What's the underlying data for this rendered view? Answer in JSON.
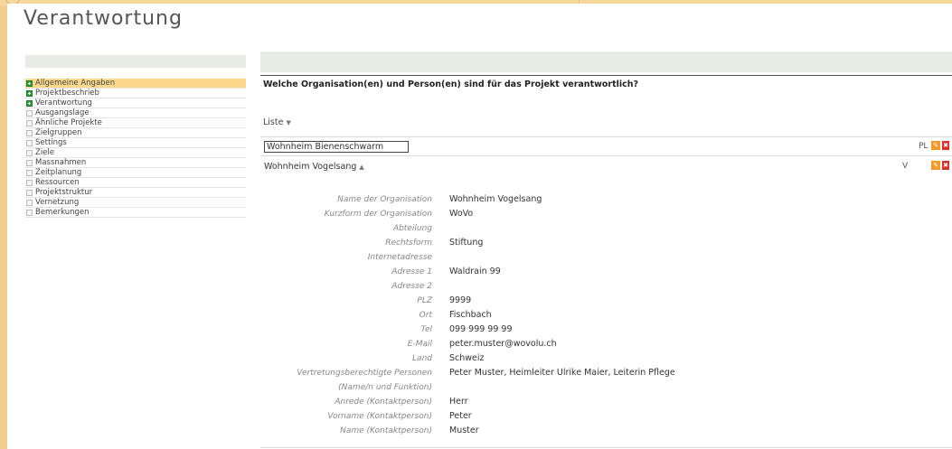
{
  "page": {
    "title": "Verantwortung"
  },
  "sidebar": {
    "items": [
      {
        "label": "Allgemeine Angaben",
        "state": "done",
        "active": true
      },
      {
        "label": "Projektbeschrieb",
        "state": "done",
        "active": false
      },
      {
        "label": "Verantwortung",
        "state": "done",
        "active": false
      },
      {
        "label": "Ausgangslage",
        "state": "empty",
        "active": false
      },
      {
        "label": "Ähnliche Projekte",
        "state": "empty",
        "active": false
      },
      {
        "label": "Zielgruppen",
        "state": "empty",
        "active": false
      },
      {
        "label": "Settings",
        "state": "empty",
        "active": false
      },
      {
        "label": "Ziele",
        "state": "empty",
        "active": false
      },
      {
        "label": "Massnahmen",
        "state": "empty",
        "active": false
      },
      {
        "label": "Zeitplanung",
        "state": "empty",
        "active": false
      },
      {
        "label": "Ressourcen",
        "state": "empty",
        "active": false
      },
      {
        "label": "Projektstruktur",
        "state": "empty",
        "active": false
      },
      {
        "label": "Vernetzung",
        "state": "empty",
        "active": false
      },
      {
        "label": "Bemerkungen",
        "state": "empty",
        "active": false
      }
    ]
  },
  "main": {
    "question": "Welche Organisation(en) und Person(en) sind für das Projekt verantwortlich?",
    "list_label": "Liste",
    "list_arrow": "▼",
    "organizations": [
      {
        "name": "Wohnheim Bienenschwarm",
        "role": "PL"
      },
      {
        "name": "Wohnheim Vogelsang",
        "expand_arrow": "▲",
        "role": "V"
      }
    ],
    "details": [
      {
        "label": "Name der Organisation",
        "value": "Wohnheim Vogelsang"
      },
      {
        "label": "Kurzform der Organisation",
        "value": "WoVo"
      },
      {
        "label": "Abteilung",
        "value": ""
      },
      {
        "label": "Rechtsform",
        "value": "Stiftung"
      },
      {
        "label": "Internetadresse",
        "value": ""
      },
      {
        "label": "Adresse 1",
        "value": "Waldrain 99"
      },
      {
        "label": "Adresse 2",
        "value": ""
      },
      {
        "label": "PLZ",
        "value": "9999"
      },
      {
        "label": "Ort",
        "value": "Fischbach"
      },
      {
        "label": "Tel",
        "value": "099 999 99 99"
      },
      {
        "label": "E-Mail",
        "value": "peter.muster@wovolu.ch"
      },
      {
        "label": "Land",
        "value": "Schweiz"
      },
      {
        "label": "Vertretungsberechtigte Personen",
        "value": "Peter Muster, Heimleiter Ulrike Maier, Leiterin Pflege"
      },
      {
        "label": "(Name/n und Funktion)",
        "value": ""
      },
      {
        "label": "Anrede (Kontaktperson)",
        "value": "Herr"
      },
      {
        "label": "Vorname (Kontaktperson)",
        "value": "Peter"
      },
      {
        "label": "Name (Kontaktperson)",
        "value": "Muster"
      }
    ]
  },
  "icons": {
    "edit": "pencil-icon",
    "delete": "trash-icon",
    "done": "plus-icon"
  },
  "colors": {
    "accent": "#fbd88b",
    "edit": "#f39a2b",
    "delete": "#d8302b",
    "done": "#2f9e3a"
  }
}
